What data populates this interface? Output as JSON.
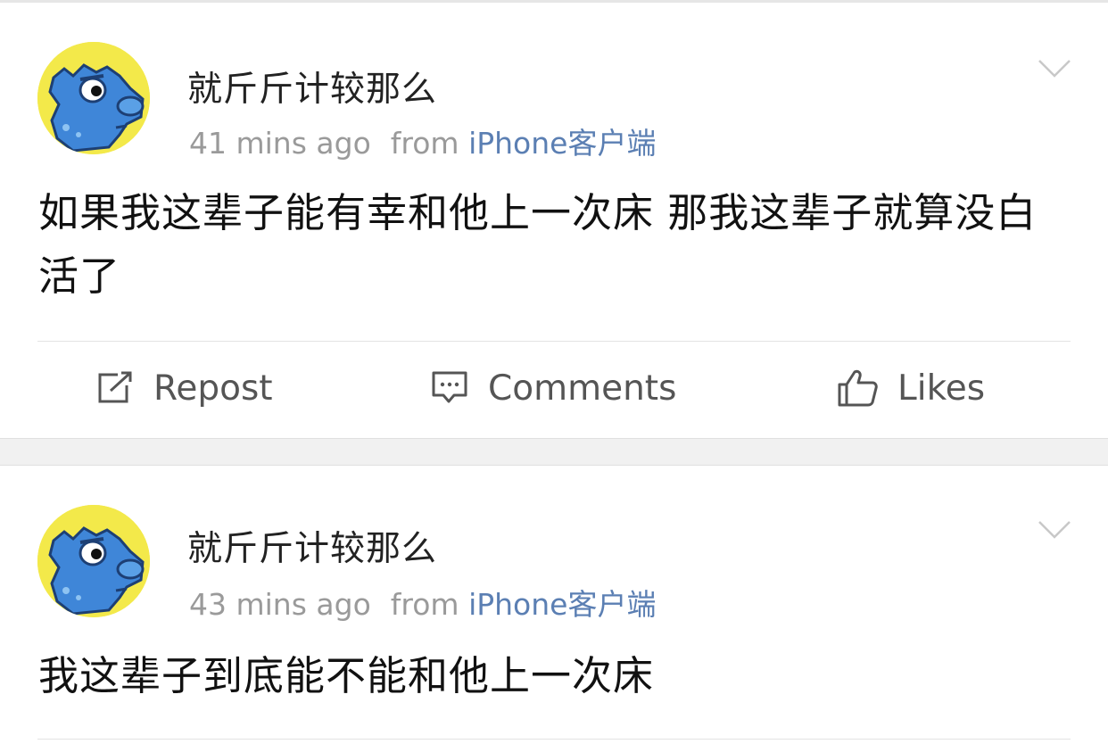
{
  "posts": [
    {
      "username": "就斤斤计较那么",
      "time": "41 mins ago",
      "from": "from",
      "source": "iPhone客户端",
      "content": "如果我这辈子能有幸和他上一次床 那我这辈子就算没白活了",
      "actions": {
        "repost": "Repost",
        "comments": "Comments",
        "likes": "Likes"
      }
    },
    {
      "username": "就斤斤计较那么",
      "time": "43 mins ago",
      "from": "from",
      "source": "iPhone客户端",
      "content": "我这辈子到底能不能和他上一次床"
    }
  ],
  "colors": {
    "source_link": "#5b7fb3",
    "meta_gray": "#9a9a9a",
    "avatar_bg": "#f3e94a",
    "avatar_figure": "#3f86d8"
  },
  "icons": [
    "avatar-image",
    "chevron-down-icon",
    "repost-icon",
    "comment-icon",
    "like-icon"
  ]
}
